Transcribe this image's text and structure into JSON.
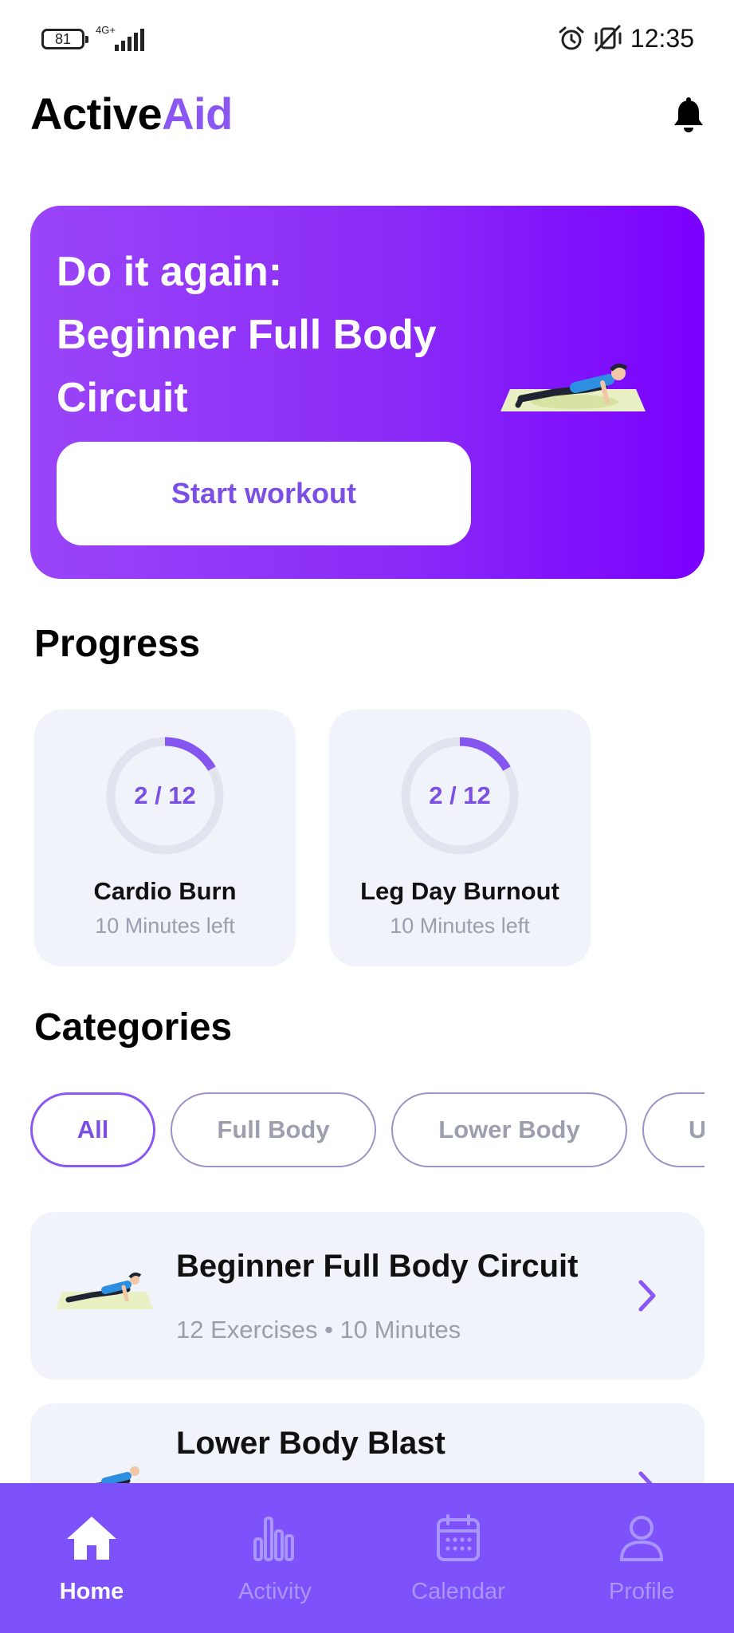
{
  "status_bar": {
    "battery": "81",
    "network": "4G+",
    "time": "12:35"
  },
  "header": {
    "brand_primary": "Active",
    "brand_accent": "Aid",
    "accent_color": "#8a57f2"
  },
  "hero": {
    "title_line1": "Do it again:",
    "title_line2": "Beginner Full Body",
    "title_line3": "Circuit",
    "button_label": "Start workout"
  },
  "progress": {
    "title": "Progress",
    "cards": [
      {
        "name": "Cardio Burn",
        "count": "2 / 12",
        "fraction": 0.1667,
        "subtitle": "10 Minutes left"
      },
      {
        "name": "Leg Day Burnout",
        "count": "2 / 12",
        "fraction": 0.1667,
        "subtitle": "10 Minutes left"
      }
    ]
  },
  "categories": {
    "title": "Categories",
    "chips": [
      {
        "label": "All",
        "active": true
      },
      {
        "label": "Full Body",
        "active": false
      },
      {
        "label": "Lower Body",
        "active": false
      },
      {
        "label": "U",
        "active": false
      }
    ]
  },
  "workouts": [
    {
      "title": "Beginner Full Body Circuit",
      "meta": "12 Exercises • 10 Minutes"
    },
    {
      "title": "Lower Body Blast",
      "meta": ""
    }
  ],
  "bottom_nav": {
    "items": [
      {
        "label": "Home",
        "icon": "home-icon",
        "active": true
      },
      {
        "label": "Activity",
        "icon": "activity-icon",
        "active": false
      },
      {
        "label": "Calendar",
        "icon": "calendar-icon",
        "active": false
      },
      {
        "label": "Profile",
        "icon": "profile-icon",
        "active": false
      }
    ]
  }
}
